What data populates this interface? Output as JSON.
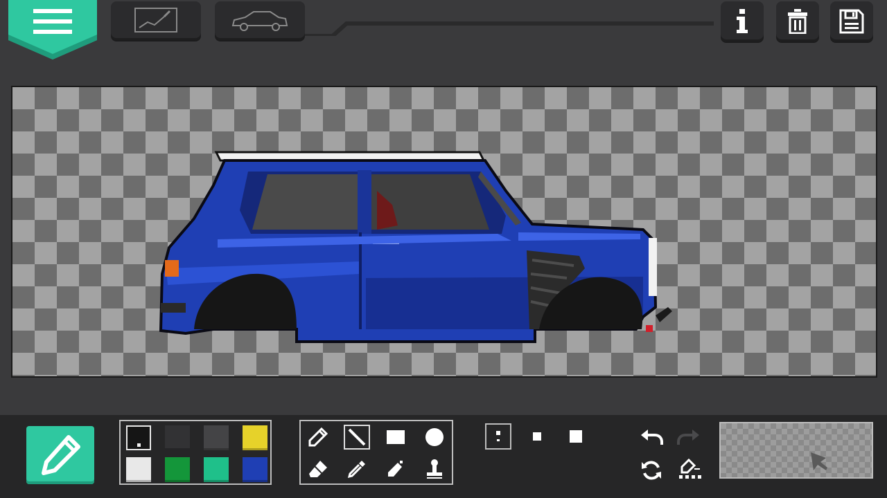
{
  "app": {
    "screen": "pixel-paint-editor"
  },
  "top_bar": {
    "menu_icon": "hamburger-icon",
    "tab_draw_icon": "sketch-canvas-icon",
    "tab_car_icon": "car-outline-icon",
    "info_icon": "info-icon",
    "delete_icon": "trash-icon",
    "save_icon": "floppy-disk-icon"
  },
  "canvas": {
    "content": "blue-hatchback-car-pixel-art",
    "background": "transparency-checkerboard"
  },
  "toolbar": {
    "active_tool_icon": "pencil-icon",
    "palette": [
      {
        "name": "black",
        "hex": "#151515",
        "selected": true
      },
      {
        "name": "dark-gray",
        "hex": "#323234",
        "selected": false
      },
      {
        "name": "gray",
        "hex": "#444446",
        "selected": false
      },
      {
        "name": "yellow",
        "hex": "#e6d22a",
        "selected": false
      },
      {
        "name": "white",
        "hex": "#e8e8e8",
        "selected": false
      },
      {
        "name": "green",
        "hex": "#14963a",
        "selected": false
      },
      {
        "name": "teal",
        "hex": "#1fc08a",
        "selected": false
      },
      {
        "name": "blue",
        "hex": "#1f3fb4",
        "selected": false
      }
    ],
    "tools": [
      {
        "icon": "pencil-icon",
        "selected": false
      },
      {
        "icon": "line-icon",
        "selected": true
      },
      {
        "icon": "rectangle-icon",
        "selected": false
      },
      {
        "icon": "circle-icon",
        "selected": false
      },
      {
        "icon": "eraser-icon",
        "selected": false
      },
      {
        "icon": "eyedropper-icon",
        "selected": false
      },
      {
        "icon": "spray-can-icon",
        "selected": false
      },
      {
        "icon": "stamp-icon",
        "selected": false
      }
    ],
    "brush_sizes": [
      "small",
      "medium",
      "large"
    ],
    "selected_brush": "small",
    "actions": [
      "undo-icon",
      "redo-icon",
      "rotate-icon",
      "layer-fill-icon"
    ],
    "redo_enabled": false
  },
  "colors": {
    "accent": "#2fc8a0",
    "panel": "#262627",
    "background": "#3a3a3c",
    "car_body": "#1f3fb4"
  }
}
